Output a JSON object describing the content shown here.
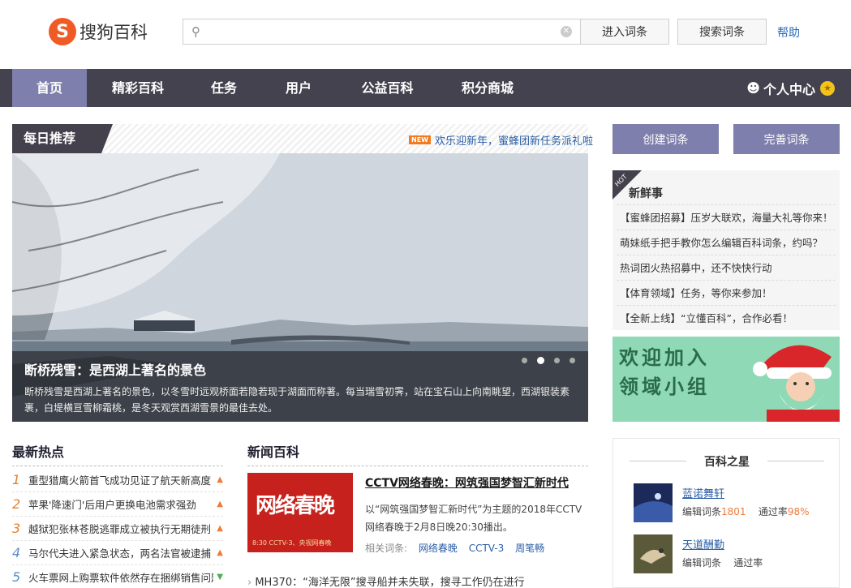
{
  "header": {
    "logo_text": "搜狗百科",
    "logo_mark": "S",
    "search_placeholder": "",
    "enter_button": "进入词条",
    "search_button": "搜索词条",
    "help_link": "帮助"
  },
  "nav": {
    "items": [
      "首页",
      "精彩百科",
      "任务",
      "用户",
      "公益百科",
      "积分商城"
    ],
    "user_center": "个人中心"
  },
  "daily": {
    "title": "每日推荐",
    "news_badge": "NEW",
    "news_text": "欢乐迎新年，蜜蜂团新任务派礼啦",
    "slide_title": "断桥残雪：是西湖上著名的景色",
    "slide_desc": "断桥残雪是西湖上著名的景色，以冬雪时远观桥面若隐若现于湖面而称著。每当瑞雪初霁，站在宝石山上向南眺望，西湖银装素裹，白堤横亘雪柳霜桃，是冬天观赏西湖雪景的最佳去处。"
  },
  "hot": {
    "title": "最新热点",
    "items": [
      {
        "num": "1",
        "text": "重型猎鹰火箭首飞成功见证了航天新高度",
        "trend": "up"
      },
      {
        "num": "2",
        "text": "苹果'降速门'后用户更换电池需求强劲",
        "trend": "up"
      },
      {
        "num": "3",
        "text": "越狱犯张林苍脱逃罪成立被执行无期徒刑",
        "trend": "up"
      },
      {
        "num": "4",
        "text": "马尔代夫进入紧急状态，两名法官被逮捕",
        "trend": "up"
      },
      {
        "num": "5",
        "text": "火车票网上购票软件依然存在捆绑销售问题",
        "trend": "down"
      }
    ]
  },
  "news": {
    "title": "新闻百科",
    "image_text": "网络春晚",
    "image_caption": "8:30 CCTV-3、央视网春晚",
    "headline": "CCTV网络春晚：网筑强国梦智汇新时代",
    "desc": "以“网筑强国梦智汇新时代”为主题的2018年CCTV网络春晚于2月8日晚20:30播出。",
    "related_label": "相关词条:",
    "related": [
      "网络春晚",
      "CCTV-3",
      "周笔畅"
    ],
    "line": "MH370：“海洋无限”搜寻船并未失联，搜寻工作仍在进行"
  },
  "right": {
    "create_button": "创建词条",
    "perfect_button": "完善词条",
    "hot_ribbon": "HOT",
    "fresh_title": "新鲜事",
    "fresh_items": [
      "【蜜蜂团招募】压岁大联欢，海量大礼等你来！",
      "萌妹纸手把手教你怎么编辑百科词条，约吗？",
      "热词团火热招募中，还不快快行动",
      "【体育领域】任务，等你来参加！",
      "【全新上线】“立懂百科”，合作必看！"
    ],
    "banner_text": [
      "欢迎加入",
      "领域小组"
    ],
    "stars_title": "百科之星",
    "stars": [
      {
        "name": "蓝诺舞轩",
        "edit_label": "编辑词条",
        "edit_count": "1801",
        "pass_label": "通过率",
        "pass_rate": "98%"
      },
      {
        "name": "天道酬勤",
        "edit_label": "编辑词条",
        "edit_count": "",
        "pass_label": "通过率",
        "pass_rate": ""
      }
    ]
  },
  "colors": {
    "nav_bg": "#43424e",
    "nav_active": "#7e7fac",
    "accent_orange": "#f07b3a",
    "link_blue": "#2a5ea6"
  }
}
